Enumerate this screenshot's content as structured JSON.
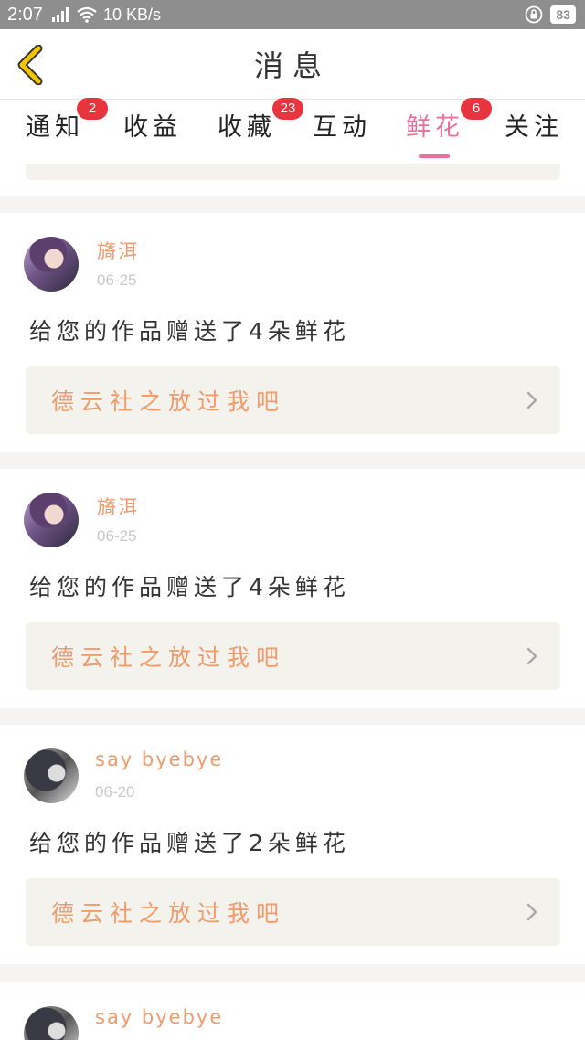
{
  "status_bar": {
    "time": "2:07",
    "network_speed": "10 KB/s",
    "battery": "83"
  },
  "header": {
    "title": "消息",
    "back_icon": "chevron-left-icon"
  },
  "tabs": [
    {
      "label": "通知",
      "badge": "2",
      "active": false
    },
    {
      "label": "收益",
      "badge": "",
      "active": false
    },
    {
      "label": "收藏",
      "badge": "23",
      "active": false
    },
    {
      "label": "互动",
      "badge": "",
      "active": false
    },
    {
      "label": "鲜花",
      "badge": "6",
      "active": true
    },
    {
      "label": "关注",
      "badge": "",
      "active": false
    }
  ],
  "messages": [
    {
      "username": "旖洱",
      "date": "06-25",
      "text": "给您的作品赠送了4朵鲜花",
      "work_title": "德云社之放过我吧"
    },
    {
      "username": "旖洱",
      "date": "06-25",
      "text": "给您的作品赠送了4朵鲜花",
      "work_title": "德云社之放过我吧"
    },
    {
      "username": "say byebye",
      "date": "06-20",
      "text": "给您的作品赠送了2朵鲜花",
      "work_title": "德云社之放过我吧"
    },
    {
      "username": "say byebye"
    }
  ],
  "colors": {
    "accent_pink": "#e8709a",
    "badge_red": "#e8343e",
    "name_orange": "#ef9b6c",
    "back_yellow": "#f2c500"
  }
}
